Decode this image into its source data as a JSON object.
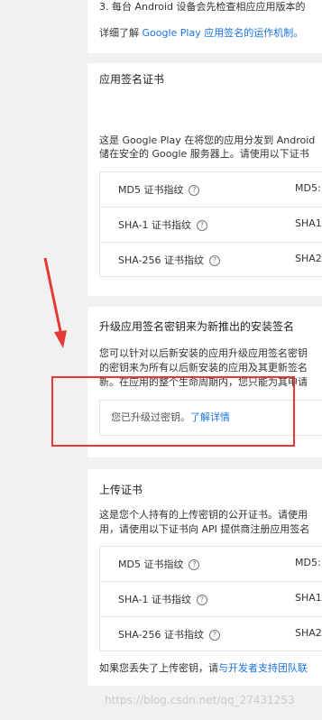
{
  "top": {
    "step": "3.  每台 Android 设备会先检查相应应用版本的",
    "learn_prefix": "详细了解 ",
    "learn_link": "Google Play 应用签名的运作机制。"
  },
  "app_signing": {
    "title": "应用签名证书",
    "desc1": "这是 Google Play 在将您的应用分发到 Android",
    "desc2": "储在安全的 Google 服务器上。请使用以下证书",
    "rows": [
      {
        "label": "MD5 证书指纹",
        "value": "MD5:"
      },
      {
        "label": "SHA-1 证书指纹",
        "value": "SHA1"
      },
      {
        "label": "SHA-256 证书指纹",
        "value": "SHA2"
      }
    ]
  },
  "upgrade": {
    "title": "升级应用签名密钥来为新推出的安装签名",
    "desc1": "您可以针对以后新安装的应用升级应用签名密钥",
    "desc2": "的密钥来为所有以后新安装的应用及其更新签名",
    "desc3": "新。在应用的整个生命周期内，您只能为其申请",
    "notice": "您已升级过密钥。",
    "notice_link": "了解详情"
  },
  "upload": {
    "title": "上传证书",
    "desc1": "这是您个人持有的上传密钥的公开证书。请使用",
    "desc2": "用，请使用以下证书向 API 提供商注册应用签名",
    "rows": [
      {
        "label": "MD5 证书指纹",
        "value": "MD5:"
      },
      {
        "label": "SHA-1 证书指纹",
        "value": "SHA1"
      },
      {
        "label": "SHA-256 证书指纹",
        "value": "SHA2"
      }
    ],
    "footer_prefix": "如果您丢失了上传密钥，请",
    "footer_link": "与开发者支持团队联"
  },
  "help_glyph": "?",
  "watermark": "https://blog.csdn.net/qq_27431253",
  "colors": {
    "annotation_red": "#e53935",
    "link": "#1a73e8"
  }
}
